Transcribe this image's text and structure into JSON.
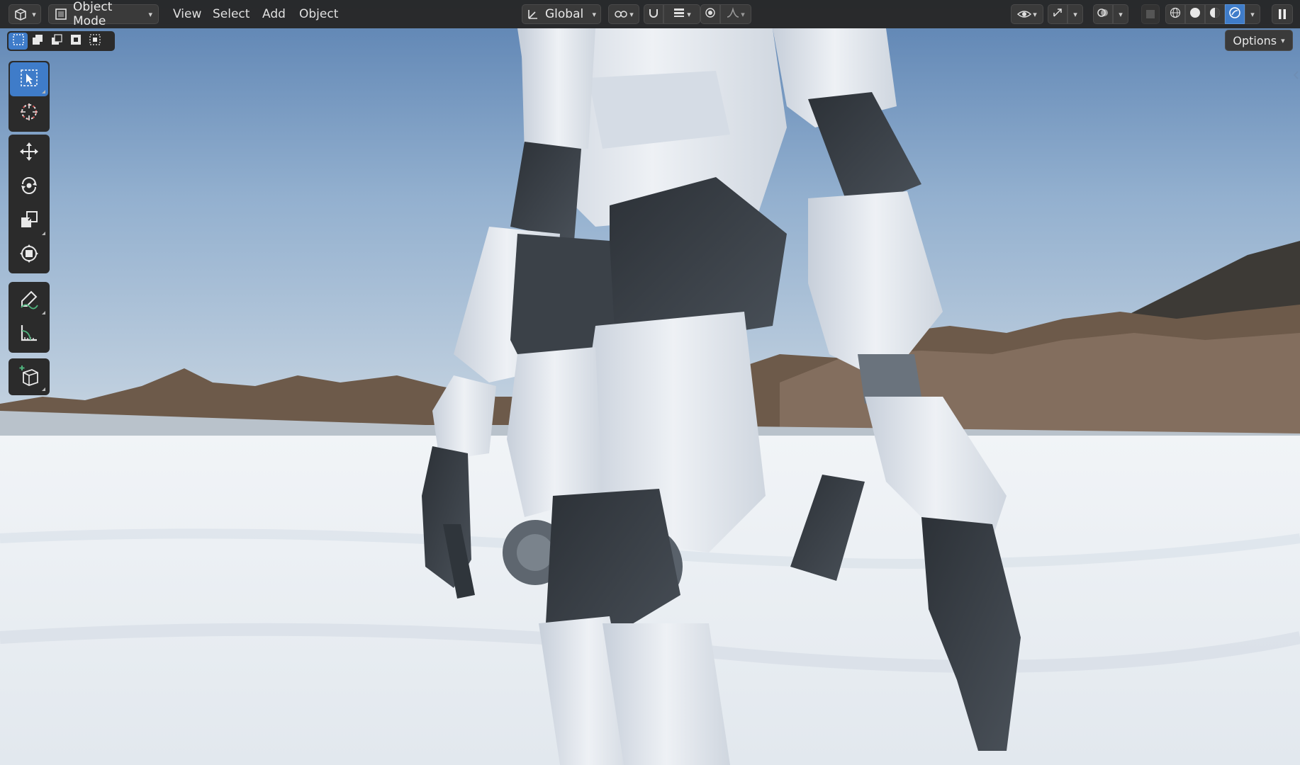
{
  "header": {
    "editor_type_icon": "3d-viewport-icon",
    "mode": {
      "label": "Object Mode",
      "icon": "object-mode-icon"
    },
    "menus": [
      {
        "label": "View"
      },
      {
        "label": "Select"
      },
      {
        "label": "Add"
      },
      {
        "label": "Object"
      }
    ],
    "transform_orientation": {
      "label": "Global",
      "icon": "orientation-global-icon"
    },
    "pivot_icon": "pivot-point-icon",
    "snap_icon": "snap-magnet-icon",
    "snap_increment_icon": "snap-increment-icon",
    "proportional_icon": "proportional-editing-icon",
    "falloff_icon": "falloff-curve-icon",
    "visibility_icon": "eye-icon",
    "gizmo_icon": "gizmo-icon",
    "overlay_icon": "overlay-icon",
    "xray_icon": "xray-icon",
    "shading": {
      "modes": [
        "wireframe",
        "solid",
        "material-preview",
        "rendered"
      ],
      "active": "rendered"
    },
    "pause_icon": "pause-icon"
  },
  "select_modes": [
    "select-new",
    "select-extend",
    "select-subtract",
    "select-invert",
    "select-intersect"
  ],
  "options": {
    "label": "Options"
  },
  "toolbar": {
    "groups": [
      [
        "select-box-icon",
        "cursor-icon"
      ],
      [
        "move-icon",
        "rotate-icon",
        "scale-icon",
        "transform-icon"
      ],
      [
        "annotate-icon",
        "measure-icon"
      ],
      [
        "add-cube-icon"
      ]
    ],
    "active": "select-box-icon"
  },
  "colors": {
    "accent": "#3f7cc9",
    "header_bg": "#262626",
    "button_bg": "#3a3a3a",
    "sky_top": "#5f86b6",
    "snow": "#e9eef3",
    "robot_white": "#e4e8ee",
    "robot_dark": "#3a4047"
  }
}
